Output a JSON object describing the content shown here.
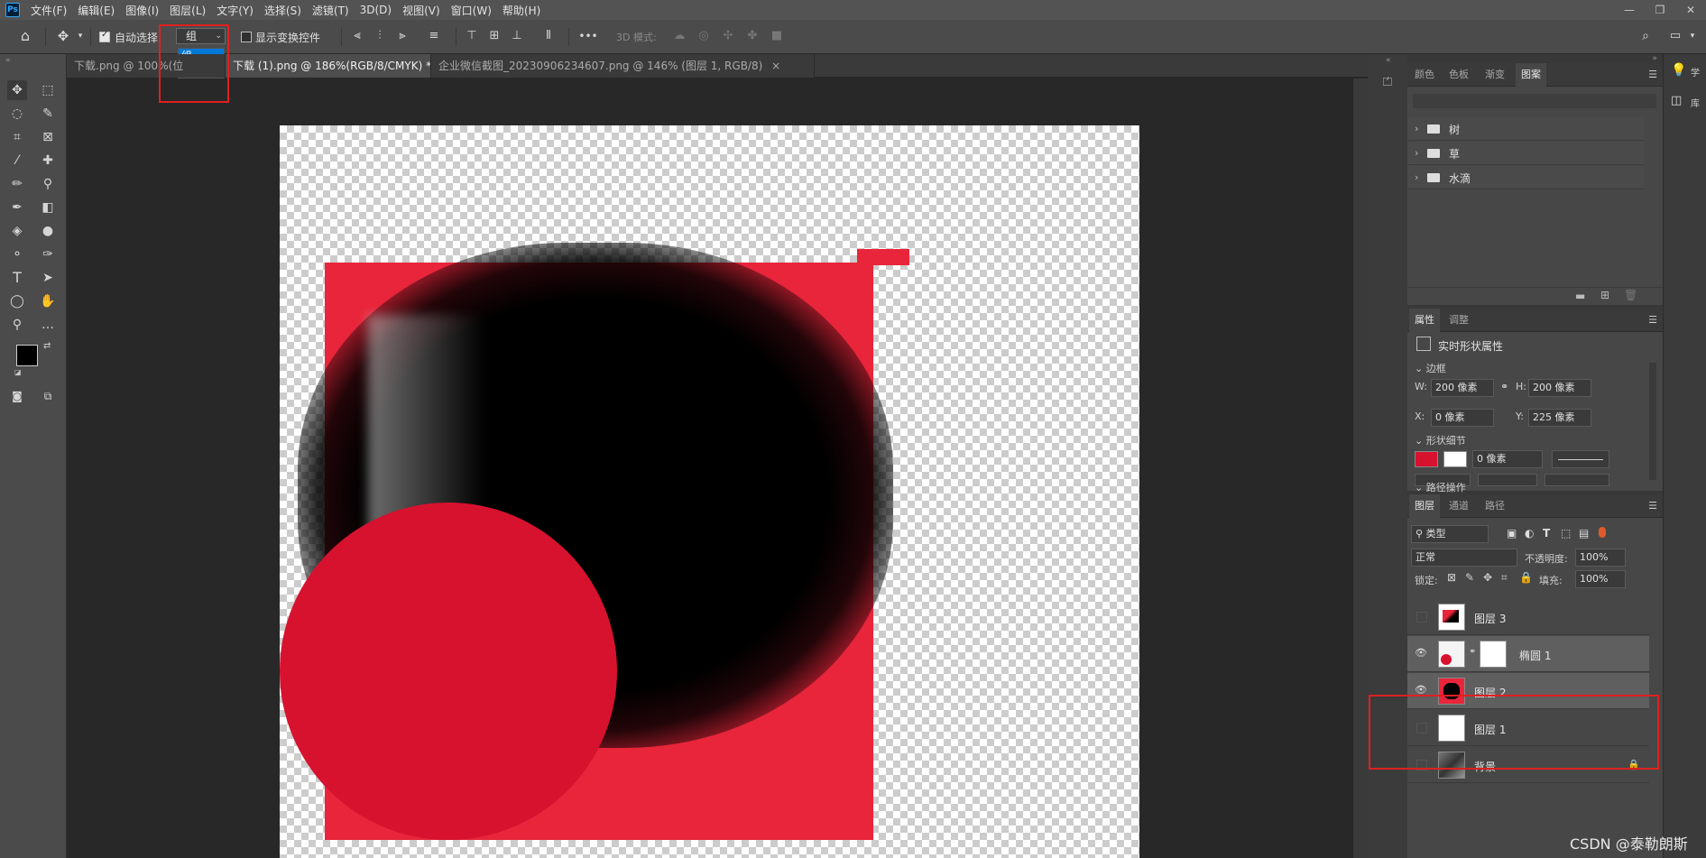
{
  "app": {
    "logo": "Ps"
  },
  "menu": [
    "文件(F)",
    "编辑(E)",
    "图像(I)",
    "图层(L)",
    "文字(Y)",
    "选择(S)",
    "滤镜(T)",
    "3D(D)",
    "视图(V)",
    "窗口(W)",
    "帮助(H)"
  ],
  "window_controls": [
    "—",
    "❐",
    "✕"
  ],
  "options": {
    "auto_select_label": "自动选择:",
    "auto_select_value": "组",
    "auto_select_options": [
      "组",
      "图层"
    ],
    "show_transform_label": "显示变换控件",
    "mode_3d_label": "3D 模式:",
    "more": "•••"
  },
  "tabs": [
    {
      "label": "下载.png @ 100%(位",
      "active": false
    },
    {
      "label": "下载 (1).png @ 186%(RGB/8/CMYK) *",
      "active": true,
      "close": "×"
    },
    {
      "label": "企业微信截图_20230906234607.png @ 146% (图层 1, RGB/8)",
      "active": false,
      "close": "×"
    }
  ],
  "swatches_panel": {
    "tabs": [
      "颜色",
      "色板",
      "渐变",
      "图案"
    ],
    "active_tab": "图案",
    "folders": [
      "树",
      "草",
      "水滴"
    ]
  },
  "properties_panel": {
    "tabs": [
      "属性",
      "调整"
    ],
    "active_tab": "属性",
    "title": "实时形状属性",
    "section_bounds": "边框",
    "w_label": "W:",
    "w_value": "200 像素",
    "h_label": "H:",
    "h_value": "200 像素",
    "x_label": "X:",
    "x_value": "0 像素",
    "y_label": "Y:",
    "y_value": "225 像素",
    "section_shape": "形状细节",
    "stroke_width": "0 像素",
    "section_path": "路径操作",
    "fill_color": "#d7122f"
  },
  "layers_panel": {
    "tabs": [
      "图层",
      "通道",
      "路径"
    ],
    "active_tab": "图层",
    "filter_label": "类型",
    "blend_mode": "正常",
    "opacity_label": "不透明度:",
    "opacity_value": "100%",
    "lock_label": "锁定:",
    "fill_label": "填充:",
    "fill_value": "100%",
    "layers": [
      {
        "name": "图层 3",
        "visible": false,
        "selected": false
      },
      {
        "name": "椭圆 1",
        "visible": true,
        "selected": true
      },
      {
        "name": "图层 2",
        "visible": true,
        "selected": true
      },
      {
        "name": "图层 1",
        "visible": false,
        "selected": false
      },
      {
        "name": "背景",
        "visible": false,
        "selected": false,
        "locked": true
      }
    ]
  },
  "right_strip": {
    "item1": "学",
    "item2": "库"
  },
  "watermark": "CSDN @泰勒朗斯",
  "colors": {
    "accent_red": "#e8253a",
    "circle_red": "#d7122f",
    "highlight": "#e02020"
  }
}
